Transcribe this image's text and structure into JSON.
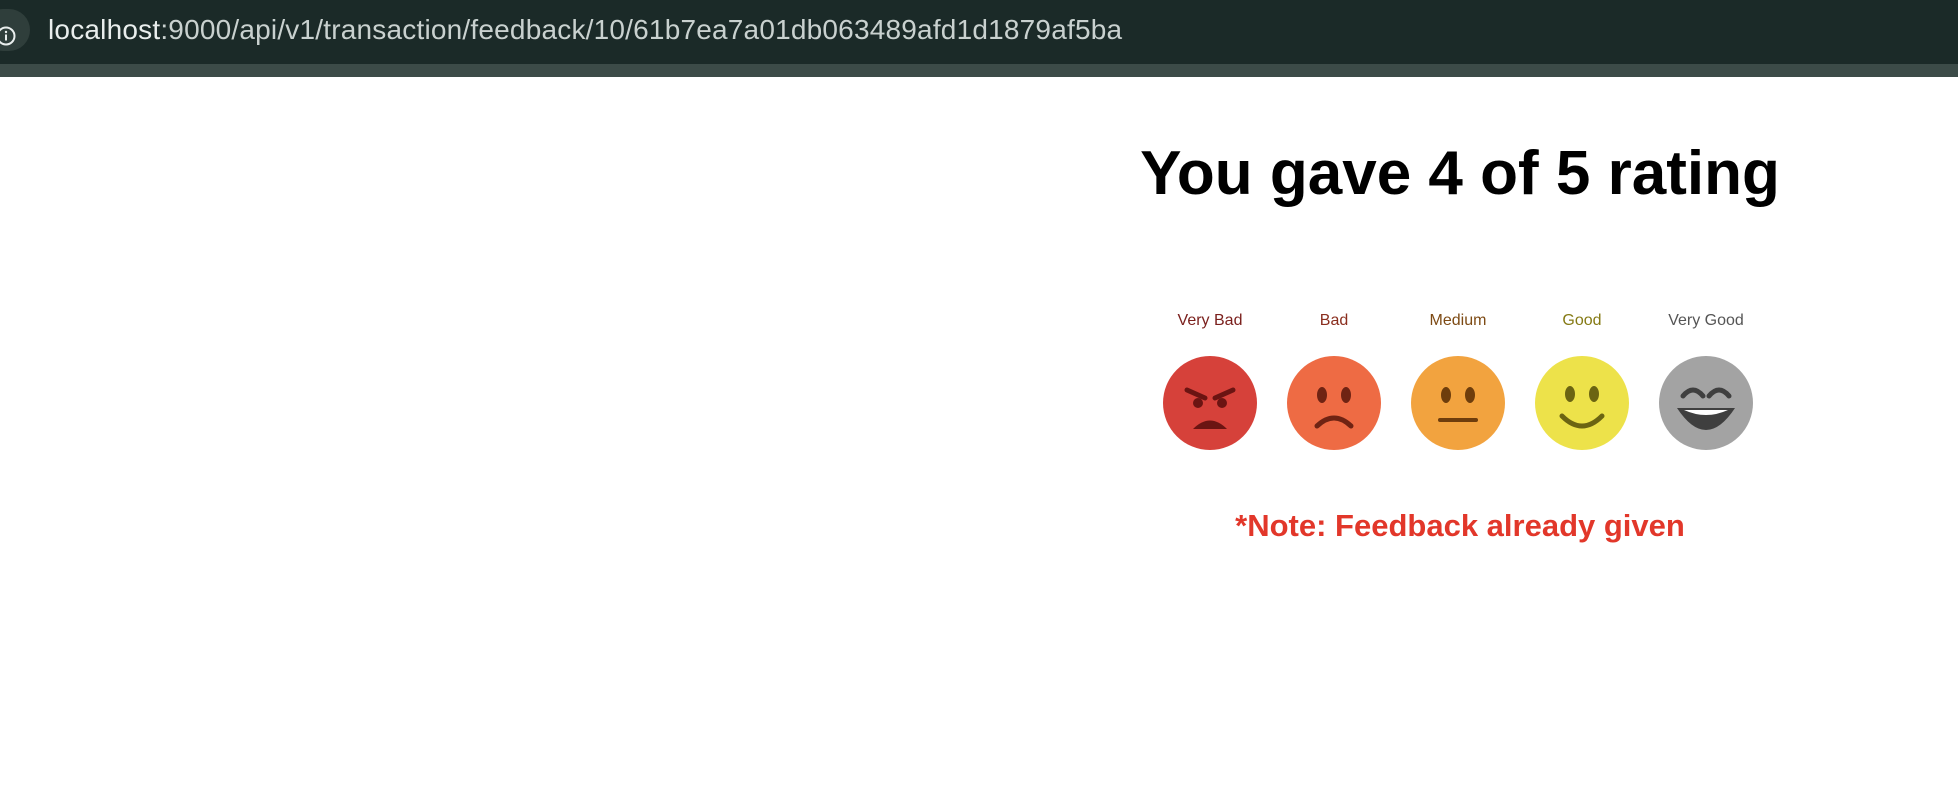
{
  "browser": {
    "url_host": "localhost",
    "url_path": ":9000/api/v1/transaction/feedback/10/61b7ea7a01db063489afd1d1879af5ba"
  },
  "page": {
    "title": "You gave 4 of 5 rating",
    "note": "*Note: Feedback already given"
  },
  "rating": {
    "given": 4,
    "max": 5,
    "options": [
      {
        "label": "Very Bad",
        "color": "#d6413a",
        "label_color": "#7a1f1c"
      },
      {
        "label": "Bad",
        "color": "#ee6b44",
        "label_color": "#8a2e1e"
      },
      {
        "label": "Medium",
        "color": "#f2a33f",
        "label_color": "#7d4a14"
      },
      {
        "label": "Good",
        "color": "#ede24a",
        "label_color": "#857a14"
      },
      {
        "label": "Very Good",
        "color": "#a3a3a3",
        "label_color": "#555555"
      }
    ]
  }
}
